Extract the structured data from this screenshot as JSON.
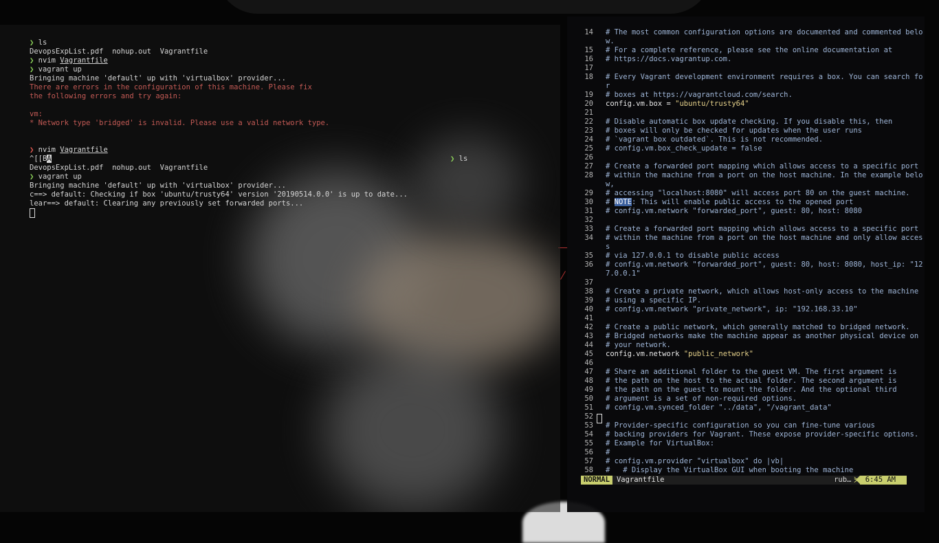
{
  "left_terminal": {
    "lines": [
      {
        "prompt": "❯",
        "prompt_color": "green",
        "cmd": "ls"
      },
      {
        "text": "DevopsExpList.pdf  nohup.out  Vagrantfile"
      },
      {
        "prompt": "❯",
        "prompt_color": "green",
        "cmd": "nvim ",
        "arg": "Vagrantfile"
      },
      {
        "prompt": "❯",
        "prompt_color": "green",
        "cmd": "vagrant up"
      },
      {
        "text": "Bringing machine 'default' up with 'virtualbox' provider..."
      },
      {
        "error": "There are errors in the configuration of this machine. Please fix"
      },
      {
        "error": "the following errors and try again:"
      },
      {
        "blank": true
      },
      {
        "error": "vm:"
      },
      {
        "error": "* Network type 'bridged' is invalid. Please use a valid network type."
      },
      {
        "blank": true
      },
      {
        "blank": true
      },
      {
        "prompt": "❯",
        "prompt_color": "red",
        "cmd": "nvim ",
        "arg": "Vagrantfile"
      },
      {
        "typed": "^[[B",
        "cursor_char": "A",
        "right_prompt": "❯",
        "right_cmd": "ls"
      },
      {
        "text": "DevopsExpList.pdf  nohup.out  Vagrantfile"
      },
      {
        "prompt": "❯",
        "prompt_color": "green",
        "cmd": "vagrant up"
      },
      {
        "text": "Bringing machine 'default' up with 'virtualbox' provider..."
      },
      {
        "text": "c==> default: Checking if box 'ubuntu/trusty64' version '20190514.0.0' is up to date..."
      },
      {
        "text": "lear==> default: Clearing any previously set forwarded ports..."
      },
      {
        "cursor": true
      }
    ]
  },
  "editor": {
    "lines": [
      {
        "n": "14",
        "t": "# The most common configuration options are documented and commented belo",
        "kind": "comment"
      },
      {
        "n": "",
        "t": "w.",
        "kind": "comment"
      },
      {
        "n": "15",
        "t": "# For a complete reference, please see the online documentation at",
        "kind": "comment"
      },
      {
        "n": "16",
        "t": "# https://docs.vagrantup.com.",
        "kind": "comment"
      },
      {
        "n": "17",
        "t": "",
        "kind": "comment"
      },
      {
        "n": "18",
        "t": "# Every Vagrant development environment requires a box. You can search fo",
        "kind": "comment"
      },
      {
        "n": "",
        "t": "r",
        "kind": "comment"
      },
      {
        "n": "19",
        "t": "# boxes at https://vagrantcloud.com/search.",
        "kind": "comment"
      },
      {
        "n": "20",
        "t": "config.vm.box = ",
        "str": "\"ubuntu/trusty64\"",
        "kind": "code"
      },
      {
        "n": "21",
        "t": "",
        "kind": "comment"
      },
      {
        "n": "22",
        "t": "# Disable automatic box update checking. If you disable this, then",
        "kind": "comment"
      },
      {
        "n": "23",
        "t": "# boxes will only be checked for updates when the user runs",
        "kind": "comment"
      },
      {
        "n": "24",
        "t": "# `vagrant box outdated`. This is not recommended.",
        "kind": "comment"
      },
      {
        "n": "25",
        "t": "# config.vm.box_check_update = false",
        "kind": "comment"
      },
      {
        "n": "26",
        "t": "",
        "kind": "comment"
      },
      {
        "n": "27",
        "t": "# Create a forwarded port mapping which allows access to a specific port",
        "kind": "comment"
      },
      {
        "n": "28",
        "t": "# within the machine from a port on the host machine. In the example belo",
        "kind": "comment"
      },
      {
        "n": "",
        "t": "w,",
        "kind": "comment"
      },
      {
        "n": "29",
        "t": "# accessing \"localhost:8080\" will access port 80 on the guest machine.",
        "kind": "comment"
      },
      {
        "n": "30",
        "pre": "# ",
        "hl": "NOTE",
        "t": ": This will enable public access to the opened port",
        "kind": "note"
      },
      {
        "n": "31",
        "t": "# config.vm.network \"forwarded_port\", guest: 80, host: 8080",
        "kind": "comment"
      },
      {
        "n": "32",
        "t": "",
        "kind": "comment"
      },
      {
        "n": "33",
        "t": "# Create a forwarded port mapping which allows access to a specific port",
        "kind": "comment"
      },
      {
        "n": "34",
        "t": "# within the machine from a port on the host machine and only allow acces",
        "kind": "comment"
      },
      {
        "n": "",
        "t": "s",
        "kind": "comment"
      },
      {
        "n": "35",
        "t": "# via 127.0.0.1 to disable public access",
        "kind": "comment"
      },
      {
        "n": "36",
        "t": "# config.vm.network \"forwarded_port\", guest: 80, host: 8080, host_ip: \"12",
        "kind": "comment"
      },
      {
        "n": "",
        "t": "7.0.0.1\"",
        "kind": "comment"
      },
      {
        "n": "37",
        "t": "",
        "kind": "comment"
      },
      {
        "n": "38",
        "t": "# Create a private network, which allows host-only access to the machine",
        "kind": "comment"
      },
      {
        "n": "39",
        "t": "# using a specific IP.",
        "kind": "comment"
      },
      {
        "n": "40",
        "t": "# config.vm.network \"private_network\", ip: \"192.168.33.10\"",
        "kind": "comment"
      },
      {
        "n": "41",
        "t": "",
        "kind": "comment"
      },
      {
        "n": "42",
        "t": "# Create a public network, which generally matched to bridged network.",
        "kind": "comment"
      },
      {
        "n": "43",
        "t": "# Bridged networks make the machine appear as another physical device on",
        "kind": "comment"
      },
      {
        "n": "44",
        "t": "# your network.",
        "kind": "comment"
      },
      {
        "n": "45",
        "t": "config.vm.network ",
        "str": "\"public_network\"",
        "kind": "code"
      },
      {
        "n": "46",
        "t": "",
        "kind": "comment"
      },
      {
        "n": "47",
        "t": "# Share an additional folder to the guest VM. The first argument is",
        "kind": "comment"
      },
      {
        "n": "48",
        "t": "# the path on the host to the actual folder. The second argument is",
        "kind": "comment"
      },
      {
        "n": "49",
        "t": "# the path on the guest to mount the folder. And the optional third",
        "kind": "comment"
      },
      {
        "n": "50",
        "t": "# argument is a set of non-required options.",
        "kind": "comment"
      },
      {
        "n": "51",
        "t": "# config.vm.synced_folder \"../data\", \"/vagrant_data\"",
        "kind": "comment"
      },
      {
        "n": "52",
        "t": "",
        "kind": "comment"
      },
      {
        "n": "53",
        "t": "# Provider-specific configuration so you can fine-tune various",
        "kind": "comment"
      },
      {
        "n": "54",
        "t": "# backing providers for Vagrant. These expose provider-specific options.",
        "kind": "comment"
      },
      {
        "n": "55",
        "t": "# Example for VirtualBox:",
        "kind": "comment"
      },
      {
        "n": "56",
        "t": "#",
        "kind": "comment"
      },
      {
        "n": "57",
        "t": "# config.vm.provider \"virtualbox\" do |vb|",
        "kind": "comment"
      },
      {
        "n": "58",
        "t": "#   # Display the VirtualBox GUI when booting the machine",
        "kind": "comment"
      }
    ],
    "status": {
      "mode": "NORMAL",
      "filename": "Vagrantfile",
      "filetype": "rub…",
      "time": "6:45 AM"
    }
  }
}
